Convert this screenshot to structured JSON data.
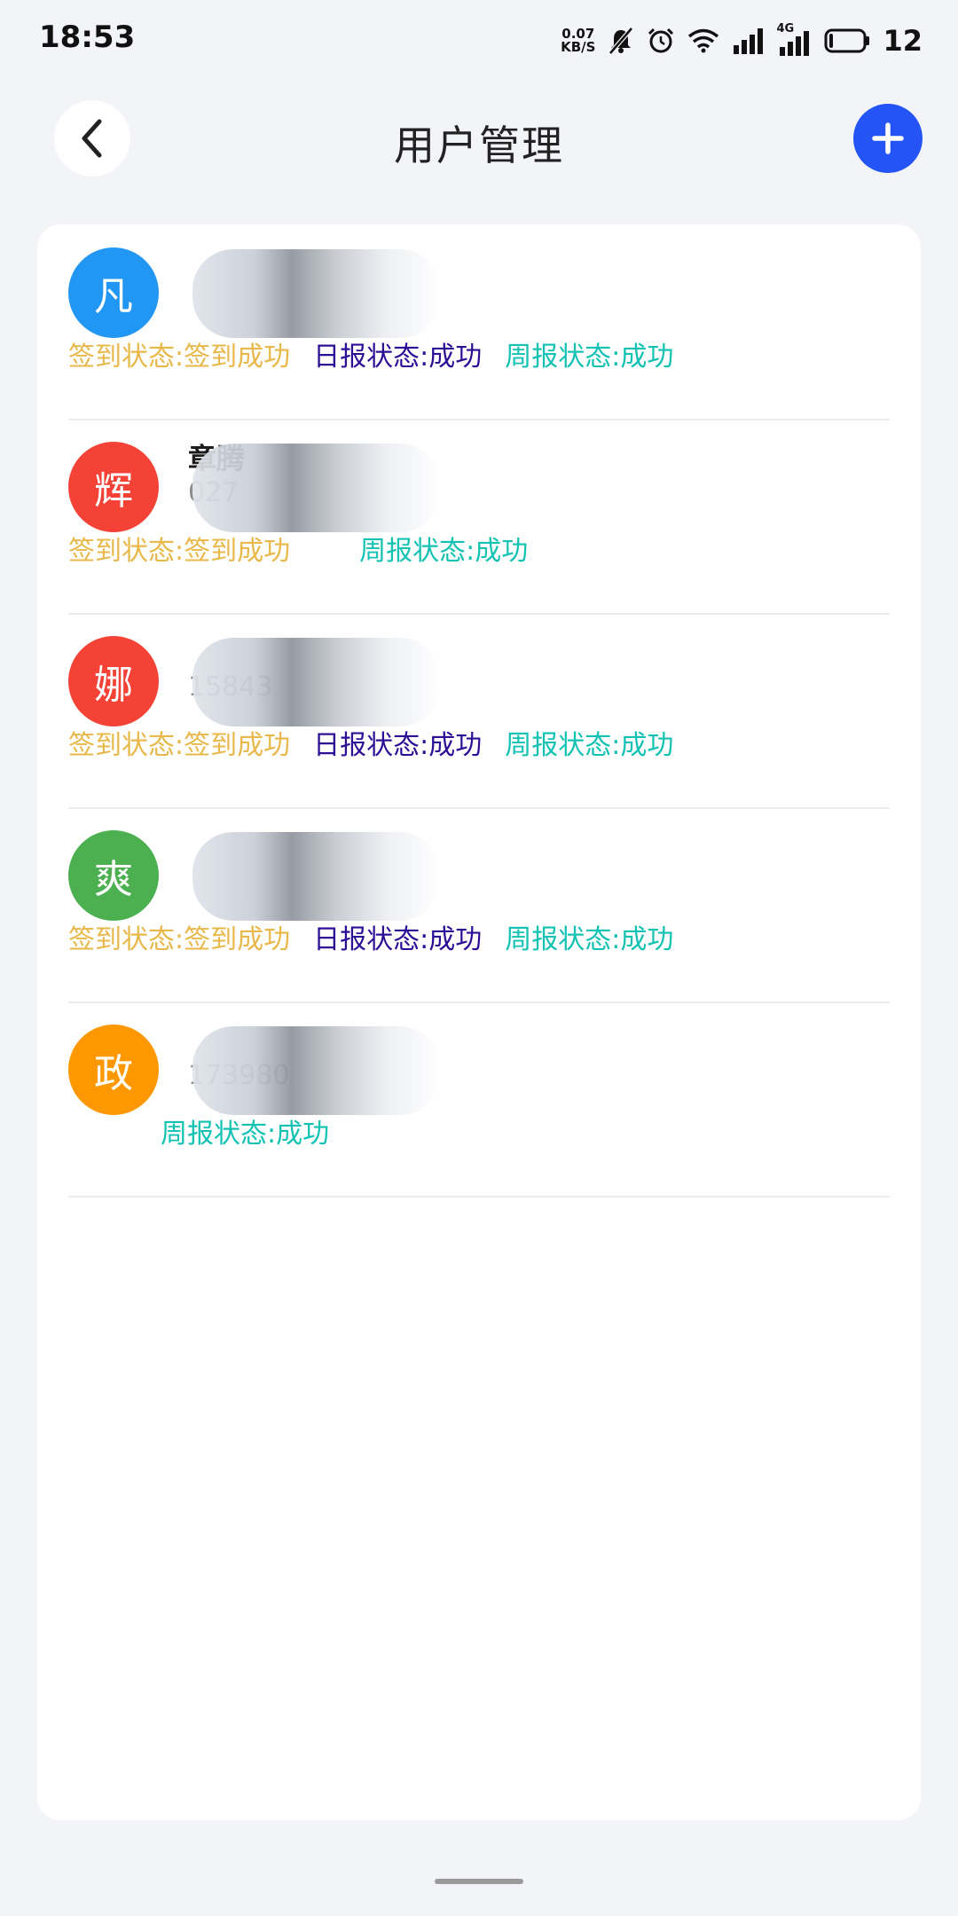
{
  "status_bar": {
    "time": "18:53",
    "net_speed_value": "0.07",
    "net_speed_unit": "KB/S",
    "net_type": "4G",
    "battery": "12",
    "icons": [
      "mute-icon",
      "alarm-icon",
      "wifi-icon",
      "signal-icon",
      "signal-4g-icon",
      "battery-icon"
    ]
  },
  "header": {
    "title": "用户管理",
    "back_icon": "chevron-left-icon",
    "add_icon": "plus-icon",
    "accent": "#2554f6"
  },
  "colors": {
    "sign": "#e8b84a",
    "daily": "#2d0f96",
    "weekly": "#13c2b3"
  },
  "users": [
    {
      "avatar_char": "凡",
      "avatar_color": "#2196f3",
      "name": "",
      "phone": "",
      "sign_status": "签到状态:签到成功",
      "daily_status": "日报状态:成功",
      "weekly_status": "周报状态:成功"
    },
    {
      "avatar_char": "辉",
      "avatar_color": "#f44336",
      "name": "章腾",
      "phone": "027",
      "sign_status": "签到状态:签到成功",
      "daily_status": "",
      "weekly_status": "周报状态:成功"
    },
    {
      "avatar_char": "娜",
      "avatar_color": "#f44336",
      "name": "",
      "phone": "15843",
      "sign_status": "签到状态:签到成功",
      "daily_status": "日报状态:成功",
      "weekly_status": "周报状态:成功"
    },
    {
      "avatar_char": "爽",
      "avatar_color": "#4caf50",
      "name": "",
      "phone": "",
      "sign_status": "签到状态:签到成功",
      "daily_status": "日报状态:成功",
      "weekly_status": "周报状态:成功"
    },
    {
      "avatar_char": "政",
      "avatar_color": "#ff9800",
      "name": "",
      "phone": "173980",
      "sign_status": "",
      "daily_status": "",
      "weekly_status": "周报状态:成功"
    }
  ]
}
